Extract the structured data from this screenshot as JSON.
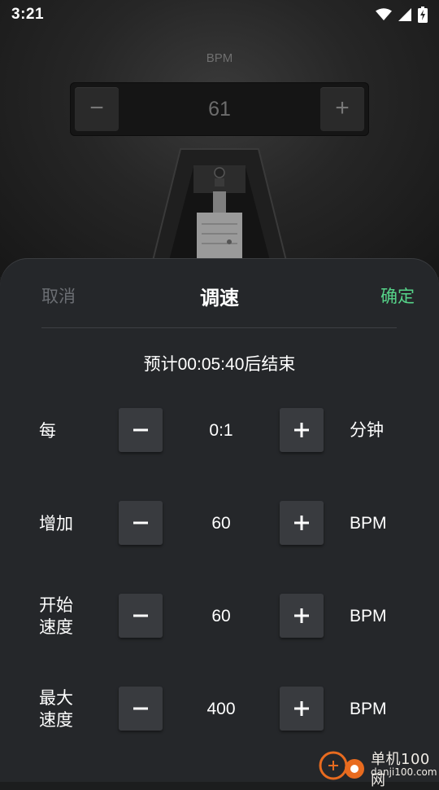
{
  "status_bar": {
    "time": "3:21",
    "icons": [
      "wifi-icon",
      "cell-signal-icon",
      "battery-charging-icon"
    ]
  },
  "metronome": {
    "bpm_label": "BPM",
    "bpm_value": "61",
    "minus_symbol": "−",
    "plus_symbol": "+"
  },
  "sheet": {
    "cancel_label": "取消",
    "title": "调速",
    "confirm_label": "确定",
    "estimate_text": "预计00:05:40后结束",
    "rows": [
      {
        "label": "每",
        "value": "0:1",
        "unit": "分钟"
      },
      {
        "label": "增加",
        "value": "60",
        "unit": "BPM"
      },
      {
        "label": "开始速度",
        "value": "60",
        "unit": "BPM"
      },
      {
        "label": "最大速度",
        "value": "400",
        "unit": "BPM"
      }
    ]
  },
  "watermark": {
    "name": "单机100网",
    "url": "danji100.com"
  },
  "colors": {
    "accent_confirm": "#56d489",
    "sheet_bg": "#25272a",
    "button_bg": "#393b3f"
  }
}
